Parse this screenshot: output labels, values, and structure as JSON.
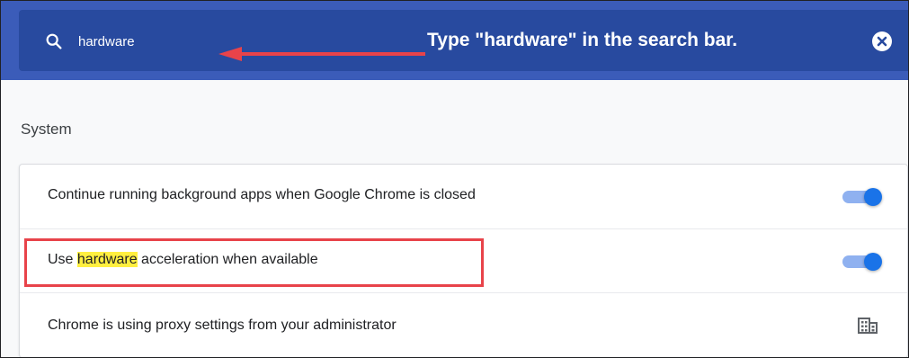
{
  "search": {
    "value": "hardware",
    "clear_icon": "close-circle-icon",
    "search_icon": "search-icon"
  },
  "annotation": {
    "text": "Type \"hardware\" in the search bar.",
    "arrow_color": "#e8434a",
    "box_color": "#e8434a"
  },
  "section": {
    "title": "System"
  },
  "settings": [
    {
      "label": "Continue running background apps when Google Chrome is closed",
      "control": "toggle",
      "enabled": true
    },
    {
      "label_before": "Use ",
      "label_highlight": "hardware",
      "label_after": " acceleration when available",
      "control": "toggle",
      "enabled": true
    },
    {
      "label": "Chrome is using proxy settings from your administrator",
      "control": "policy-icon"
    }
  ],
  "colors": {
    "header_bg": "#3b5cb9",
    "search_bg": "#284a9f",
    "toggle_on": "#1a73e8",
    "highlight": "#ffef40"
  }
}
